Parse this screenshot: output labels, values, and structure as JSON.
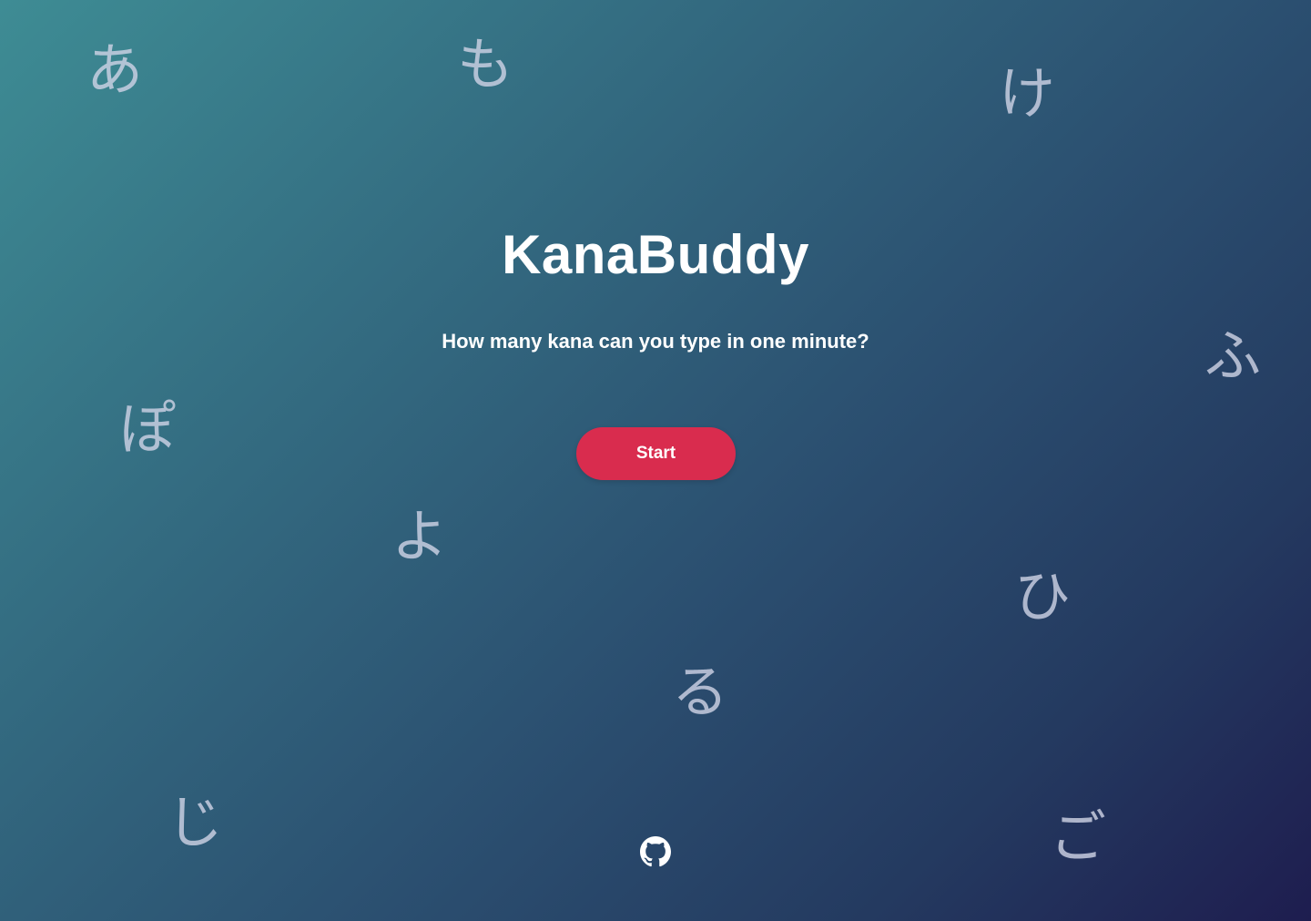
{
  "app": {
    "title": "KanaBuddy",
    "subtitle": "How many kana can you type in one minute?",
    "start_label": "Start"
  },
  "background_kana": [
    "あ",
    "も",
    "け",
    "ふ",
    "ぽ",
    "よ",
    "ひ",
    "る",
    "じ",
    "ご"
  ],
  "footer": {
    "icon": "github-icon"
  },
  "colors": {
    "accent": "#d92c4e",
    "gradient_start": "#3e8c94",
    "gradient_end": "#1e1d4f"
  }
}
